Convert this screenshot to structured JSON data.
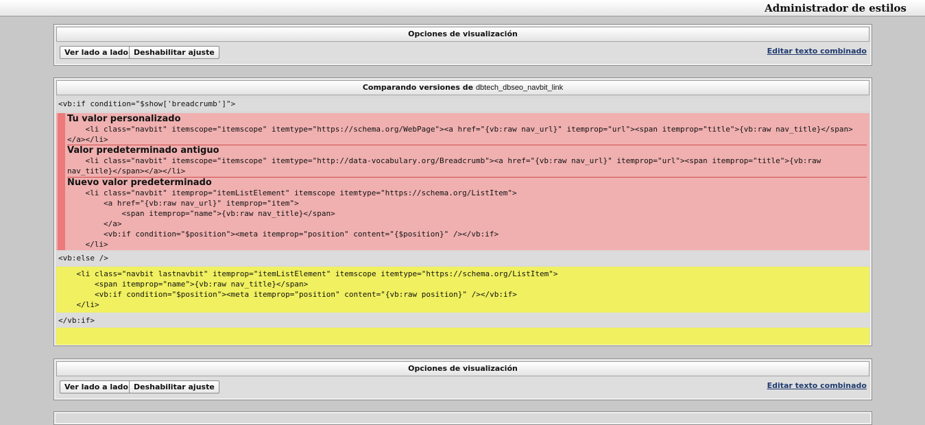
{
  "header": {
    "title": "Administrador de estilos"
  },
  "display_options": {
    "title": "Opciones de visualización",
    "side_by_side": "Ver lado a lado",
    "disable_wrap": "Deshabilitar ajuste",
    "edit_merged": "Editar texto combinado"
  },
  "compare": {
    "title_prefix": "Comparando versiones de",
    "template_name": "dbtech_dbseo_navbit_link",
    "line_if": "<vb:if condition=\"$show['breadcrumb']\">",
    "custom_label": "Tu valor personalizado",
    "custom_code": "    <li class=\"navbit\" itemscope=\"itemscope\" itemtype=\"https://schema.org/WebPage\"><a href=\"{vb:raw nav_url}\" itemprop=\"url\"><span itemprop=\"title\">{vb:raw nav_title}</span></a></li>",
    "old_label": "Valor predeterminado antiguo",
    "old_code": "    <li class=\"navbit\" itemscope=\"itemscope\" itemtype=\"http://data-vocabulary.org/Breadcrumb\"><a href=\"{vb:raw nav_url}\" itemprop=\"url\"><span itemprop=\"title\">{vb:raw nav_title}</span></a></li>",
    "new_label": "Nuevo valor predeterminado",
    "new_code": "    <li class=\"navbit\" itemprop=\"itemListElement\" itemscope itemtype=\"https://schema.org/ListItem\">\n        <a href=\"{vb:raw nav_url}\" itemprop=\"item\">\n            <span itemprop=\"name\">{vb:raw nav_title}</span>\n        </a>\n        <vb:if condition=\"$position\"><meta itemprop=\"position\" content=\"{$position}\" /></vb:if>\n    </li>",
    "line_else": "<vb:else />",
    "else_code": "    <li class=\"navbit lastnavbit\" itemprop=\"itemListElement\" itemscope itemtype=\"https://schema.org/ListItem\">\n        <span itemprop=\"name\">{vb:raw nav_title}</span>\n        <vb:if condition=\"$position\"><meta itemprop=\"position\" content=\"{vb:raw position}\" /></vb:if>\n    </li>",
    "line_endif": "</vb:if>"
  },
  "colors": {
    "conflict_bg": "#f0b0b0",
    "conflict_marker": "#ec7a7a",
    "added_bg": "#f0f060",
    "context_bg": "#dcdcdc"
  }
}
